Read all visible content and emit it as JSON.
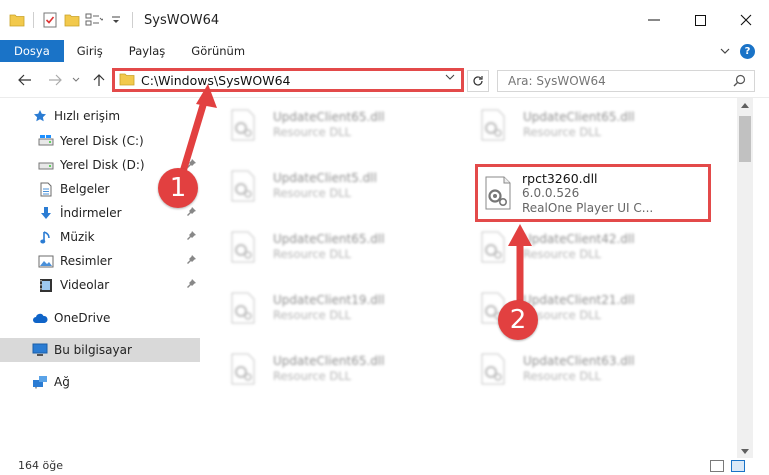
{
  "window": {
    "title": "SysWOW64"
  },
  "ribbon": {
    "tabs": [
      {
        "label": "Dosya",
        "active": true
      },
      {
        "label": "Giriş"
      },
      {
        "label": "Paylaş"
      },
      {
        "label": "Görünüm"
      }
    ],
    "help": "?"
  },
  "address_bar": {
    "path": "C:\\Windows\\SysWOW64"
  },
  "search": {
    "placeholder": "Ara: SysWOW64"
  },
  "sidebar": {
    "quick_access": "Hızlı erişim",
    "items": [
      {
        "label": "Yerel Disk (C:)",
        "icon": "drive-icon"
      },
      {
        "label": "Yerel Disk (D:)",
        "icon": "drive-icon"
      },
      {
        "label": "Belgeler",
        "icon": "documents-icon"
      },
      {
        "label": "İndirmeler",
        "icon": "download-icon"
      },
      {
        "label": "Müzik",
        "icon": "music-icon"
      },
      {
        "label": "Resimler",
        "icon": "pictures-icon"
      },
      {
        "label": "Videolar",
        "icon": "video-icon"
      }
    ],
    "onedrive": "OneDrive",
    "this_pc": "Bu bilgisayar",
    "network": "Ağ"
  },
  "files": {
    "left": [
      {
        "name": "UpdateClient65.dll",
        "desc": "Resource DLL"
      },
      {
        "name": "UpdateClient5.dll",
        "desc": "Resource DLL"
      },
      {
        "name": "UpdateClient65.dll",
        "desc": "Resource DLL"
      },
      {
        "name": "UpdateClient19.dll",
        "desc": "Resource DLL"
      },
      {
        "name": "UpdateClient65.dll",
        "desc": "Resource DLL"
      }
    ],
    "right": [
      {
        "name": "UpdateClient65.dll",
        "desc": "Resource DLL"
      },
      {
        "name": "UpdateClient42.dll",
        "desc": "Resource DLL"
      },
      {
        "name": "UpdateClient21.dll",
        "desc": "Resource DLL"
      },
      {
        "name": "UpdateClient63.dll",
        "desc": "Resource DLL"
      }
    ],
    "highlighted": {
      "name": "rpct3260.dll",
      "version": "6.0.0.526",
      "desc": "RealOne Player UI C..."
    }
  },
  "status": {
    "count": "164 öğe"
  },
  "annotations": {
    "step1": "1",
    "step2": "2"
  },
  "colors": {
    "accent": "#1a73c7",
    "highlight": "#e34a4a"
  }
}
